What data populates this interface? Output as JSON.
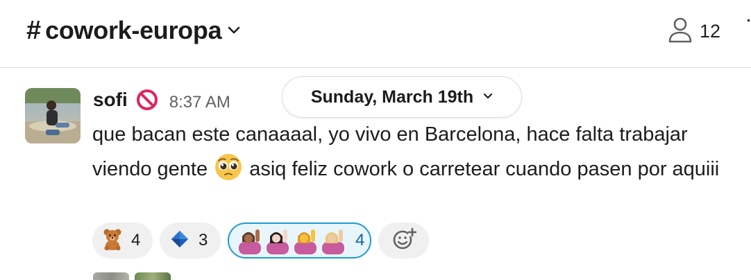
{
  "header": {
    "channel_hash": "#",
    "channel_name": "cowork-europa",
    "member_count": "12"
  },
  "message": {
    "author": "sofi",
    "status_icon": "no-entry-icon",
    "time": "8:37 AM",
    "text_before_emoji": "que bacan este canaaaal, yo vivo en Barcelona, hace falta trabajar viendo gente ",
    "inline_emoji": "pleading-face-emoji",
    "text_after_emoji": " asiq feliz cowork o carretear cuando pasen por aquiii"
  },
  "date_divider": {
    "label": "Sunday, March 19th"
  },
  "reactions": [
    {
      "emoji": "teddy-bear-emoji",
      "count": "4"
    },
    {
      "emoji": "blue-diamond-emoji",
      "count": "3"
    },
    {
      "emoji": "woman-raising-hand-emoji",
      "count": "4",
      "selected": true
    },
    {
      "emoji": "add-reaction-icon"
    }
  ],
  "colors": {
    "selected_reaction_border": "#1d9bd1",
    "selected_reaction_bg": "#e8f5fa",
    "selected_count": "#1264a3",
    "status_red": "#e0245e"
  }
}
